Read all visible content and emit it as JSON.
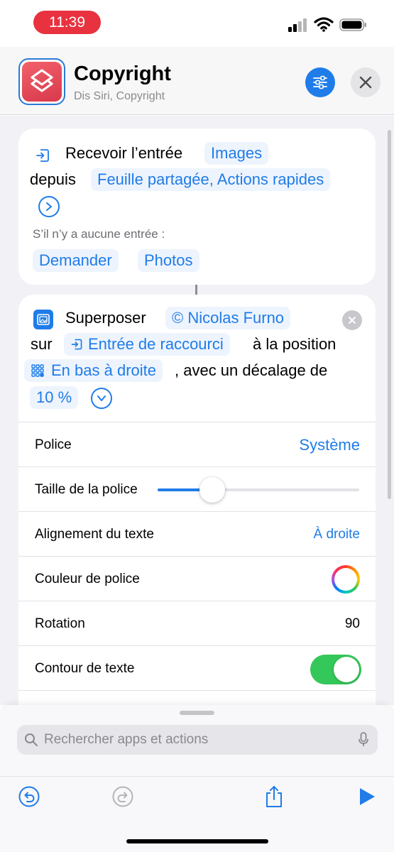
{
  "status_bar": {
    "time": "11:39",
    "icons": [
      "signal-icon",
      "wifi-icon",
      "battery-icon"
    ]
  },
  "header": {
    "title": "Copyright",
    "subtitle": "Dis Siri, Copyright",
    "app_icon": "shortcuts-icon",
    "settings_icon": "sliders-icon",
    "close_icon": "close-icon"
  },
  "receive_action": {
    "label": "Recevoir l’entrée",
    "type_token": "Images",
    "from_label": "depuis",
    "source_token": "Feuille partagée, Actions rapides",
    "no_input_label": "S’il n’y a aucune entrée :",
    "fallback_action": "Demander",
    "fallback_target": "Photos"
  },
  "overlay_action": {
    "label": "Superposer",
    "text_token": "© Nicolas Furno",
    "on_label": "sur",
    "input_token": "Entrée de raccourci",
    "position_label": "à la position",
    "position_token": "En bas à droite",
    "offset_label": ", avec un décalage de",
    "offset_token": "10 %",
    "params": {
      "font_label": "Police",
      "font_value": "Système",
      "font_size_label": "Taille de la police",
      "font_size_level": 0.27,
      "alignment_label": "Alignement du texte",
      "alignment_value": "À droite",
      "color_label": "Couleur de police",
      "rotation_label": "Rotation",
      "rotation_value": "90",
      "outline_label": "Contour de texte",
      "outline_on": true
    }
  },
  "search": {
    "placeholder": "Rechercher apps et actions"
  },
  "toolbar": {
    "icons": [
      "undo-icon",
      "redo-icon",
      "share-icon",
      "play-icon"
    ]
  },
  "colors": {
    "accent": "#1f7ce8",
    "time_pill": "#e8323f",
    "toggle_on": "#34c759",
    "app_icon": "#e24a58"
  }
}
